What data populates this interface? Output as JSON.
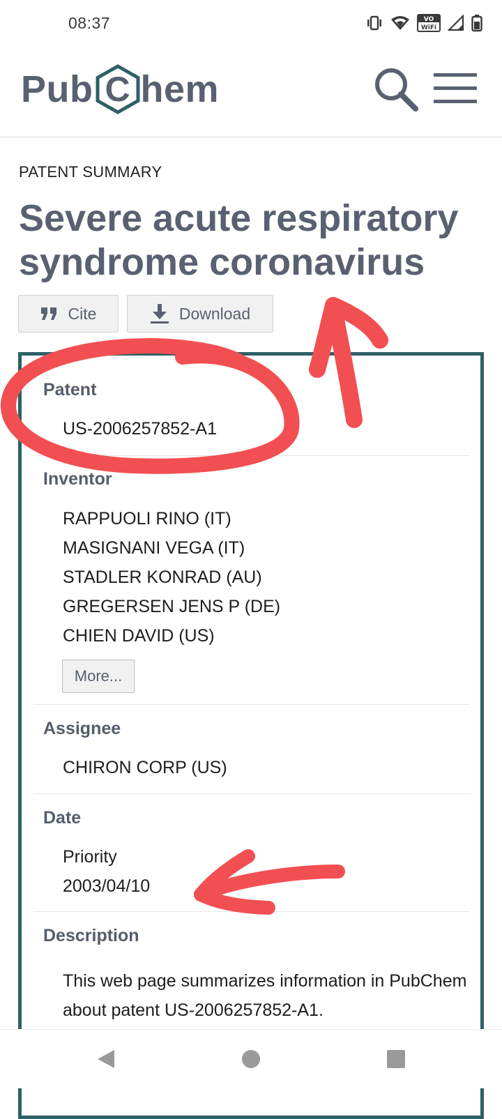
{
  "status_bar": {
    "time": "08:37",
    "wifi_badge_top": "VO",
    "wifi_badge_bottom": "WiFi",
    "icons": [
      "vibrate-icon",
      "wifi-icon",
      "vowifi-icon",
      "signal-icon",
      "battery-icon"
    ]
  },
  "header": {
    "logo_left": "Pub",
    "logo_hex_letter": "C",
    "logo_right": "hem",
    "brand_colors": {
      "text": "#596171",
      "hexagon": "#2e6067"
    }
  },
  "page": {
    "section_label": "PATENT SUMMARY",
    "title": "Severe acute respiratory syndrome coronavirus",
    "cite_label": "Cite",
    "download_label": "Download"
  },
  "summary": {
    "patent": {
      "label": "Patent",
      "value": "US-2006257852-A1"
    },
    "inventor": {
      "label": "Inventor",
      "names": [
        "RAPPUOLI RINO (IT)",
        "MASIGNANI VEGA (IT)",
        "STADLER KONRAD (AU)",
        "GREGERSEN JENS P (DE)",
        "CHIEN DAVID (US)"
      ],
      "more_label": "More..."
    },
    "assignee": {
      "label": "Assignee",
      "value": "CHIRON CORP (US)"
    },
    "date": {
      "label": "Date",
      "type": "Priority",
      "value": "2003/04/10"
    },
    "description": {
      "label": "Description",
      "text": "This web page summarizes information in PubChem about patent US-2006257852-A1."
    }
  },
  "annotation_color": "#f24f52"
}
